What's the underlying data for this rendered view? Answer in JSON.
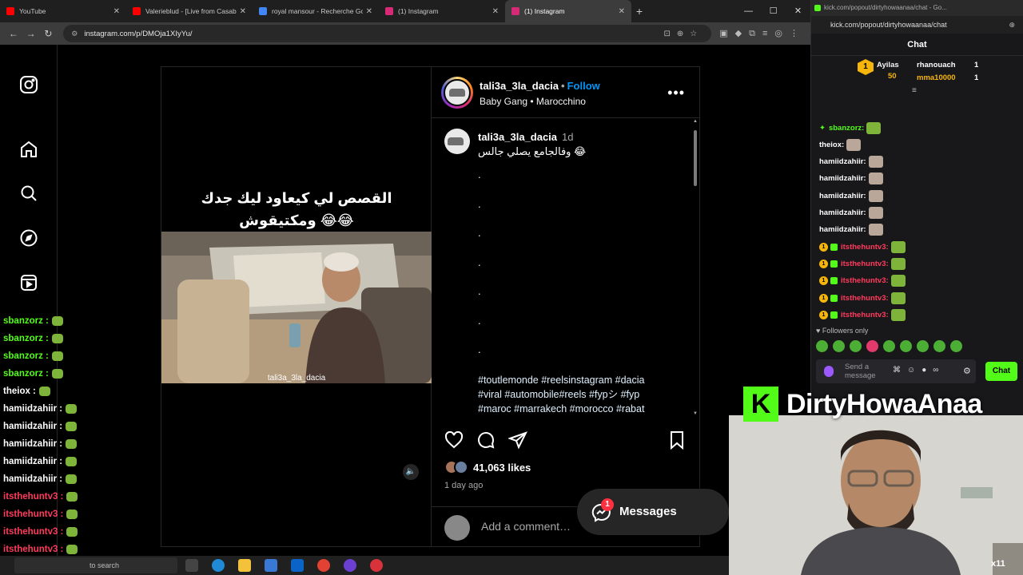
{
  "browser": {
    "tabs": [
      {
        "label": "YouTube",
        "color": "#ff0000",
        "active": false
      },
      {
        "label": "Valerieblud - [Live from Casablanca]",
        "color": "#ff0000",
        "active": false
      },
      {
        "label": "royal mansour - Recherche Google",
        "color": "#4285f4",
        "active": false
      },
      {
        "label": "(1) Instagram",
        "color": "#d62976",
        "active": false
      },
      {
        "label": "(1) Instagram",
        "color": "#d62976",
        "active": true
      }
    ],
    "url": "instagram.com/p/DMOja1XIyYu/",
    "new_tab": "+"
  },
  "post": {
    "media_caption_line1": "القصص لي كيعاود ليك جدك",
    "media_caption_line2": "ومكتيقوش 😂😂",
    "watermark": "tali3a_3la_dacia",
    "author": "tali3a_3la_dacia",
    "follow": "Follow",
    "subtitle": "Baby Gang • Marocchino",
    "comment": {
      "user": "tali3a_3la_dacia",
      "time": "1d",
      "text": "وفالجامع يصلي جالس 😂",
      "dots": [
        ".",
        ".",
        ".",
        ".",
        ".",
        ".",
        "."
      ],
      "hashtags_line1": "#toutlemonde #reelsinstagram #dacia",
      "hashtags_line2": "#viral #automobile#reels #fypシ #fyp",
      "hashtags_line3": "#maroc #marrakech #morocco #rabat"
    },
    "likes": "41,063 likes",
    "posted": "1 day ago",
    "add_comment_placeholder": "Add a comment…"
  },
  "messages": {
    "label": "Messages",
    "badge": "1"
  },
  "overlay_chat": [
    {
      "name": "sbanzorz :",
      "color": "#53fc18"
    },
    {
      "name": "sbanzorz :",
      "color": "#53fc18"
    },
    {
      "name": "sbanzorz :",
      "color": "#53fc18"
    },
    {
      "name": "sbanzorz :",
      "color": "#53fc18"
    },
    {
      "name": "theiox :",
      "color": "#ffffff"
    },
    {
      "name": "hamiidzahiir :",
      "color": "#ffffff"
    },
    {
      "name": "hamiidzahiir :",
      "color": "#ffffff"
    },
    {
      "name": "hamiidzahiir :",
      "color": "#ffffff"
    },
    {
      "name": "hamiidzahiir :",
      "color": "#ffffff"
    },
    {
      "name": "hamiidzahiir :",
      "color": "#ffffff"
    },
    {
      "name": "itsthehuntv3 :",
      "color": "#ff3b5c"
    },
    {
      "name": "itsthehuntv3 :",
      "color": "#ff3b5c"
    },
    {
      "name": "itsthehuntv3 :",
      "color": "#ff3b5c"
    },
    {
      "name": "itsthehuntv3 :",
      "color": "#ff3b5c"
    }
  ],
  "taskbar": {
    "search": "to search"
  },
  "kick": {
    "title": "kick.com/popout/dirtyhowaanaa/chat - Go...",
    "url": "kick.com/popout/dirtyhowaanaa/chat",
    "header": "Chat",
    "leaderboard": [
      {
        "name": "Ayilas",
        "value": "50",
        "color": "#f5b50a"
      },
      {
        "name": "rhanouach",
        "value": "1",
        "color": "#ffffff"
      },
      {
        "name": "mma10000",
        "value": "1",
        "color": "#f5b50a"
      }
    ],
    "messages": [
      {
        "name": "sbanzorz:",
        "color": "#53fc18"
      },
      {
        "name": "theiox:",
        "color": "#ffffff"
      },
      {
        "name": "hamiidzahiir:",
        "color": "#ffffff"
      },
      {
        "name": "hamiidzahiir:",
        "color": "#ffffff"
      },
      {
        "name": "hamiidzahiir:",
        "color": "#ffffff"
      },
      {
        "name": "hamiidzahiir:",
        "color": "#ffffff"
      },
      {
        "name": "hamiidzahiir:",
        "color": "#ffffff"
      },
      {
        "name": "itsthehuntv3:",
        "color": "#ff3b5c"
      },
      {
        "name": "itsthehuntv3:",
        "color": "#ff3b5c"
      },
      {
        "name": "itsthehuntv3:",
        "color": "#ff3b5c"
      },
      {
        "name": "itsthehuntv3:",
        "color": "#ff3b5c"
      },
      {
        "name": "itsthehuntv3:",
        "color": "#ff3b5c"
      }
    ],
    "followers_only": "Followers only",
    "input_placeholder": "Send a message",
    "chat_button": "Chat",
    "brand_color": "#53fc18"
  },
  "stream": {
    "brand_letter": "K",
    "channel_name": "DirtyHowaAnaa",
    "cam_tag": "x11"
  }
}
